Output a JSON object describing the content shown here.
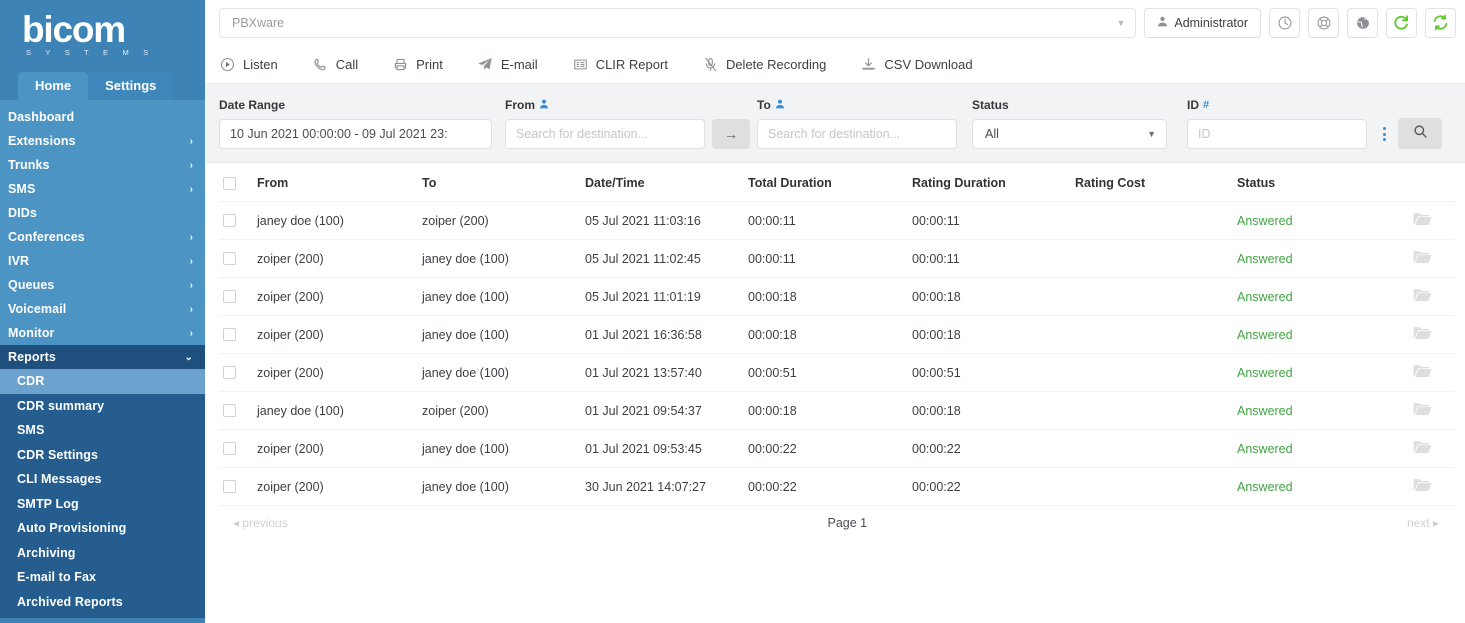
{
  "brand": {
    "name": "bicom",
    "tagline": "S Y S T E M S",
    "accent": "#3d83b5"
  },
  "sidebar": {
    "tabs": [
      {
        "label": "Home",
        "active": true
      },
      {
        "label": "Settings",
        "active": false
      }
    ],
    "items": [
      {
        "label": "Dashboard",
        "chevron": ""
      },
      {
        "label": "Extensions",
        "chevron": "›"
      },
      {
        "label": "Trunks",
        "chevron": "›"
      },
      {
        "label": "SMS",
        "chevron": "›"
      },
      {
        "label": "DIDs",
        "chevron": ""
      },
      {
        "label": "Conferences",
        "chevron": "›"
      },
      {
        "label": "IVR",
        "chevron": "›"
      },
      {
        "label": "Queues",
        "chevron": "›"
      },
      {
        "label": "Voicemail",
        "chevron": "›"
      },
      {
        "label": "Monitor",
        "chevron": "›"
      },
      {
        "label": "Reports",
        "chevron": "⌄",
        "open": true
      }
    ],
    "submenu": [
      {
        "label": "CDR",
        "active": true
      },
      {
        "label": "CDR summary",
        "active": false
      },
      {
        "label": "SMS",
        "active": false
      },
      {
        "label": "CDR Settings",
        "active": false
      },
      {
        "label": "CLI Messages",
        "active": false
      },
      {
        "label": "SMTP Log",
        "active": false
      },
      {
        "label": "Auto Provisioning",
        "active": false
      },
      {
        "label": "Archiving",
        "active": false
      },
      {
        "label": "E-mail to Fax",
        "active": false
      },
      {
        "label": "Archived Reports",
        "active": false
      }
    ]
  },
  "topbar": {
    "server_select": "PBXware",
    "user_button": "Administrator",
    "icons": [
      {
        "name": "clock-icon"
      },
      {
        "name": "lifebuoy-icon"
      },
      {
        "name": "globe-icon"
      },
      {
        "name": "refresh-icon",
        "color": "#5cc52b"
      },
      {
        "name": "sync-icon",
        "color": "#5cc52b"
      }
    ]
  },
  "toolbar": {
    "actions": [
      {
        "label": "Listen",
        "icon": "play-circle-icon"
      },
      {
        "label": "Call",
        "icon": "phone-icon"
      },
      {
        "label": "Print",
        "icon": "printer-icon"
      },
      {
        "label": "E-mail",
        "icon": "paper-plane-icon"
      },
      {
        "label": "CLIR Report",
        "icon": "list-icon"
      },
      {
        "label": "Delete Recording",
        "icon": "microphone-slash-icon"
      },
      {
        "label": "CSV Download",
        "icon": "download-icon"
      }
    ]
  },
  "filters": {
    "date_range": {
      "label": "Date Range",
      "value": "10 Jun 2021 00:00:00 - 09 Jul 2021 23:"
    },
    "from": {
      "label": "From",
      "placeholder": "Search for destination...",
      "value": ""
    },
    "to": {
      "label": "To",
      "placeholder": "Search for destination...",
      "value": ""
    },
    "status": {
      "label": "Status",
      "value": "All"
    },
    "id": {
      "label": "ID",
      "placeholder": "ID",
      "value": ""
    },
    "swap_arrow": "→"
  },
  "table": {
    "headers": [
      "From",
      "To",
      "Date/Time",
      "Total Duration",
      "Rating Duration",
      "Rating Cost",
      "Status"
    ],
    "rows": [
      {
        "from": "janey doe (100)",
        "to": "zoiper (200)",
        "datetime": "05 Jul 2021 11:03:16",
        "total_duration": "00:00:11",
        "rating_duration": "00:00:11",
        "rating_cost": "",
        "status": "Answered"
      },
      {
        "from": "zoiper (200)",
        "to": "janey doe (100)",
        "datetime": "05 Jul 2021 11:02:45",
        "total_duration": "00:00:11",
        "rating_duration": "00:00:11",
        "rating_cost": "",
        "status": "Answered"
      },
      {
        "from": "zoiper (200)",
        "to": "janey doe (100)",
        "datetime": "05 Jul 2021 11:01:19",
        "total_duration": "00:00:18",
        "rating_duration": "00:00:18",
        "rating_cost": "",
        "status": "Answered"
      },
      {
        "from": "zoiper (200)",
        "to": "janey doe (100)",
        "datetime": "01 Jul 2021 16:36:58",
        "total_duration": "00:00:18",
        "rating_duration": "00:00:18",
        "rating_cost": "",
        "status": "Answered"
      },
      {
        "from": "zoiper (200)",
        "to": "janey doe (100)",
        "datetime": "01 Jul 2021 13:57:40",
        "total_duration": "00:00:51",
        "rating_duration": "00:00:51",
        "rating_cost": "",
        "status": "Answered"
      },
      {
        "from": "janey doe (100)",
        "to": "zoiper (200)",
        "datetime": "01 Jul 2021 09:54:37",
        "total_duration": "00:00:18",
        "rating_duration": "00:00:18",
        "rating_cost": "",
        "status": "Answered"
      },
      {
        "from": "zoiper (200)",
        "to": "janey doe (100)",
        "datetime": "01 Jul 2021 09:53:45",
        "total_duration": "00:00:22",
        "rating_duration": "00:00:22",
        "rating_cost": "",
        "status": "Answered"
      },
      {
        "from": "zoiper (200)",
        "to": "janey doe (100)",
        "datetime": "30 Jun 2021 14:07:27",
        "total_duration": "00:00:22",
        "rating_duration": "00:00:22",
        "rating_cost": "",
        "status": "Answered"
      }
    ]
  },
  "pager": {
    "previous": "◂ previous",
    "page": "Page 1",
    "next": "next ▸"
  },
  "annotation": {
    "color": "#ee0000"
  }
}
